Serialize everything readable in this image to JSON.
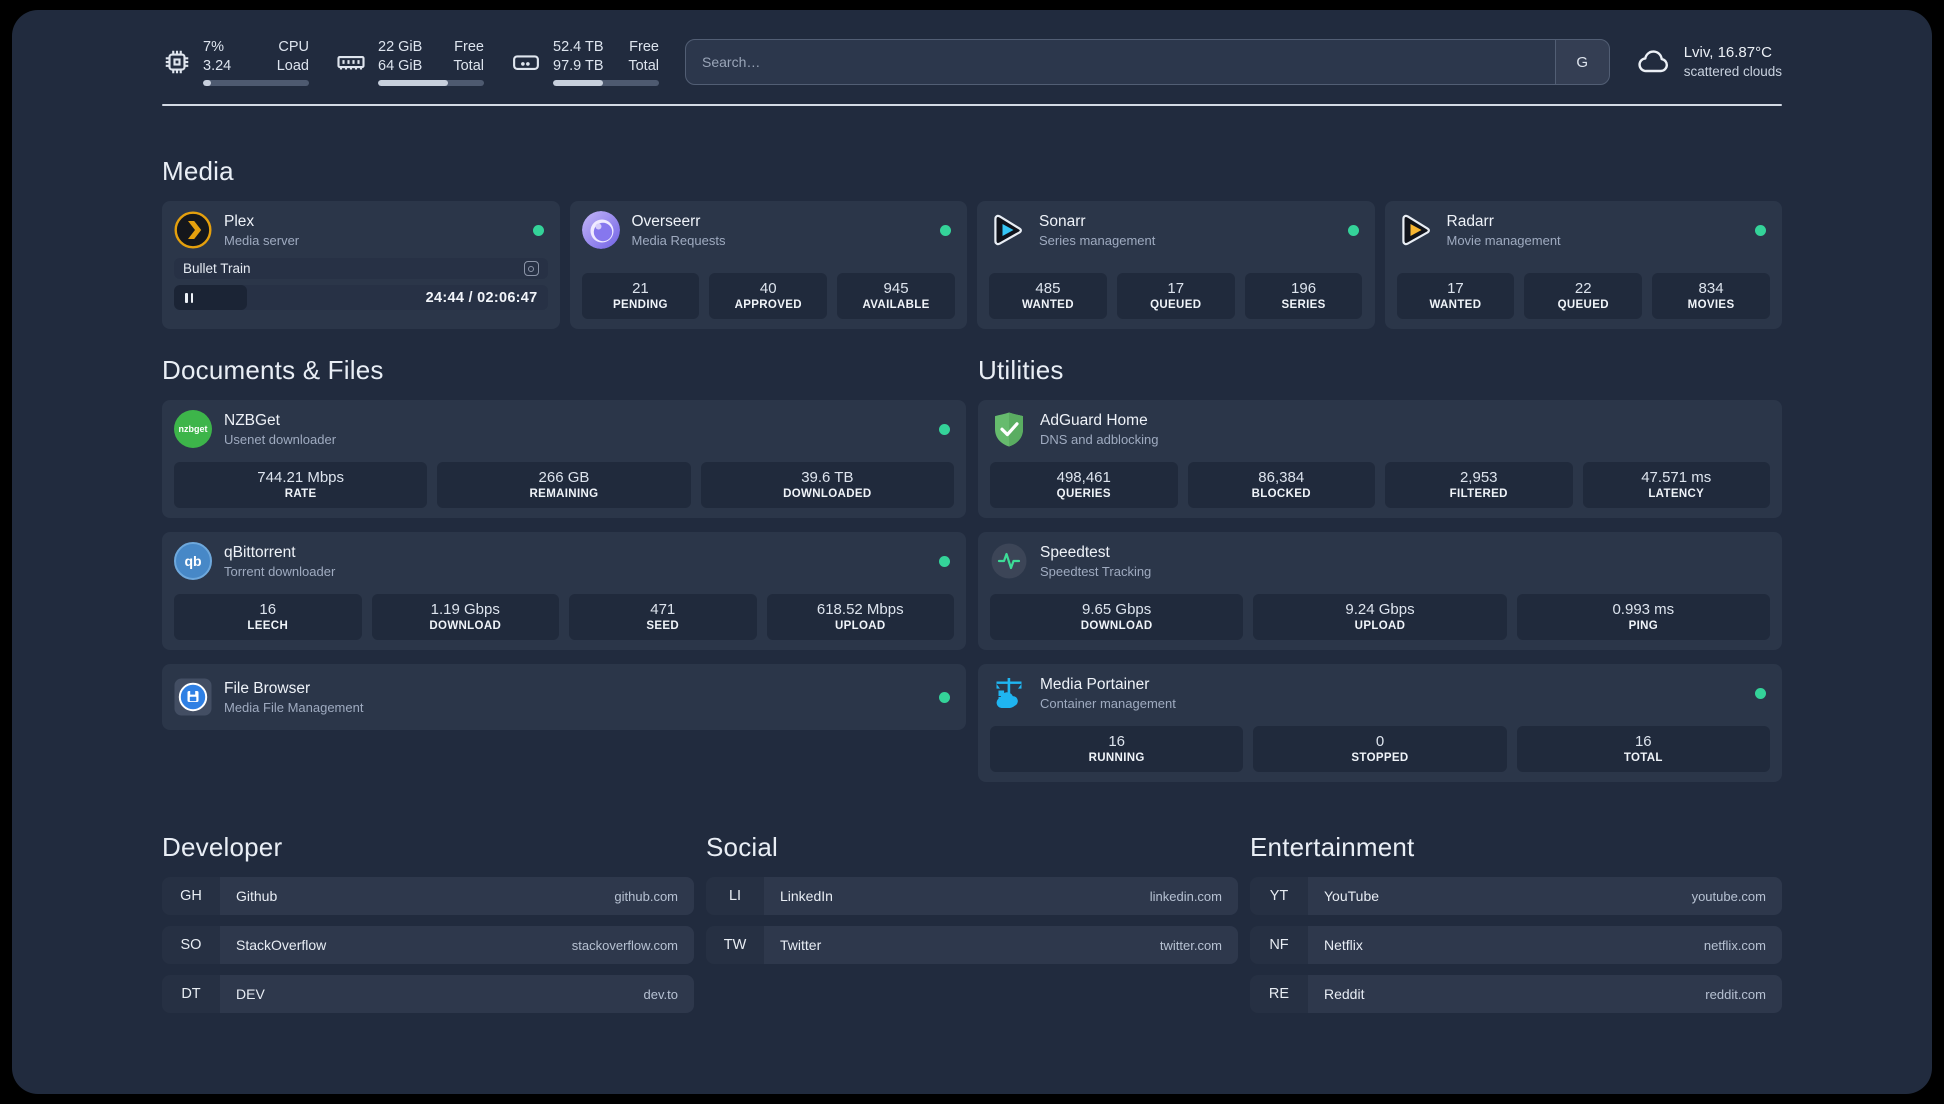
{
  "topbar": {
    "resources": [
      {
        "icon": "cpu-icon",
        "values": [
          "7%",
          "3.24"
        ],
        "labels": [
          "CPU",
          "Load"
        ],
        "progress_pct": 8
      },
      {
        "icon": "memory-icon",
        "values": [
          "22 GiB",
          "64 GiB"
        ],
        "labels": [
          "Free",
          "Total"
        ],
        "progress_pct": 66
      },
      {
        "icon": "disk-icon",
        "values": [
          "52.4 TB",
          "97.9 TB"
        ],
        "labels": [
          "Free",
          "Total"
        ],
        "progress_pct": 47
      }
    ],
    "search": {
      "placeholder": "Search…",
      "provider_button": "G"
    },
    "weather": {
      "line1": "Lviv, 16.87°C",
      "line2": "scattered clouds"
    }
  },
  "media": {
    "heading": "Media",
    "plex": {
      "title": "Plex",
      "subtitle": "Media server",
      "now_playing": "Bullet Train",
      "time": "24:44 / 02:06:47",
      "progress_pct": 19.5
    },
    "overseerr": {
      "title": "Overseerr",
      "subtitle": "Media Requests",
      "stats": [
        {
          "value": "21",
          "label": "PENDING"
        },
        {
          "value": "40",
          "label": "APPROVED"
        },
        {
          "value": "945",
          "label": "AVAILABLE"
        }
      ]
    },
    "sonarr": {
      "title": "Sonarr",
      "subtitle": "Series management",
      "stats": [
        {
          "value": "485",
          "label": "WANTED"
        },
        {
          "value": "17",
          "label": "QUEUED"
        },
        {
          "value": "196",
          "label": "SERIES"
        }
      ]
    },
    "radarr": {
      "title": "Radarr",
      "subtitle": "Movie management",
      "stats": [
        {
          "value": "17",
          "label": "WANTED"
        },
        {
          "value": "22",
          "label": "QUEUED"
        },
        {
          "value": "834",
          "label": "MOVIES"
        }
      ]
    }
  },
  "documents": {
    "heading": "Documents & Files",
    "nzbget": {
      "title": "NZBGet",
      "subtitle": "Usenet downloader",
      "logo_text": "nzbget",
      "stats": [
        {
          "value": "744.21 Mbps",
          "label": "RATE"
        },
        {
          "value": "266 GB",
          "label": "REMAINING"
        },
        {
          "value": "39.6 TB",
          "label": "DOWNLOADED"
        }
      ]
    },
    "qbittorrent": {
      "title": "qBittorrent",
      "subtitle": "Torrent downloader",
      "logo_text": "qb",
      "stats": [
        {
          "value": "16",
          "label": "LEECH"
        },
        {
          "value": "1.19 Gbps",
          "label": "DOWNLOAD"
        },
        {
          "value": "471",
          "label": "SEED"
        },
        {
          "value": "618.52 Mbps",
          "label": "UPLOAD"
        }
      ]
    },
    "filebrowser": {
      "title": "File Browser",
      "subtitle": "Media File Management"
    }
  },
  "utilities": {
    "heading": "Utilities",
    "adguard": {
      "title": "AdGuard Home",
      "subtitle": "DNS and adblocking",
      "stats": [
        {
          "value": "498,461",
          "label": "QUERIES"
        },
        {
          "value": "86,384",
          "label": "BLOCKED"
        },
        {
          "value": "2,953",
          "label": "FILTERED"
        },
        {
          "value": "47.571 ms",
          "label": "LATENCY"
        }
      ]
    },
    "speedtest": {
      "title": "Speedtest",
      "subtitle": "Speedtest Tracking",
      "stats": [
        {
          "value": "9.65 Gbps",
          "label": "DOWNLOAD"
        },
        {
          "value": "9.24 Gbps",
          "label": "UPLOAD"
        },
        {
          "value": "0.993 ms",
          "label": "PING"
        }
      ]
    },
    "portainer": {
      "title": "Media Portainer",
      "subtitle": "Container management",
      "stats": [
        {
          "value": "16",
          "label": "RUNNING"
        },
        {
          "value": "0",
          "label": "STOPPED"
        },
        {
          "value": "16",
          "label": "TOTAL"
        }
      ]
    }
  },
  "bookmarks": {
    "developer": {
      "heading": "Developer",
      "items": [
        {
          "abbr": "GH",
          "name": "Github",
          "url": "github.com"
        },
        {
          "abbr": "SO",
          "name": "StackOverflow",
          "url": "stackoverflow.com"
        },
        {
          "abbr": "DT",
          "name": "DEV",
          "url": "dev.to"
        }
      ]
    },
    "social": {
      "heading": "Social",
      "items": [
        {
          "abbr": "LI",
          "name": "LinkedIn",
          "url": "linkedin.com"
        },
        {
          "abbr": "TW",
          "name": "Twitter",
          "url": "twitter.com"
        }
      ]
    },
    "entertainment": {
      "heading": "Entertainment",
      "items": [
        {
          "abbr": "YT",
          "name": "YouTube",
          "url": "youtube.com"
        },
        {
          "abbr": "NF",
          "name": "Netflix",
          "url": "netflix.com"
        },
        {
          "abbr": "RE",
          "name": "Reddit",
          "url": "reddit.com"
        }
      ]
    }
  },
  "colors": {
    "status_online": "#34d399",
    "accent_plex": "#e5a00d"
  }
}
